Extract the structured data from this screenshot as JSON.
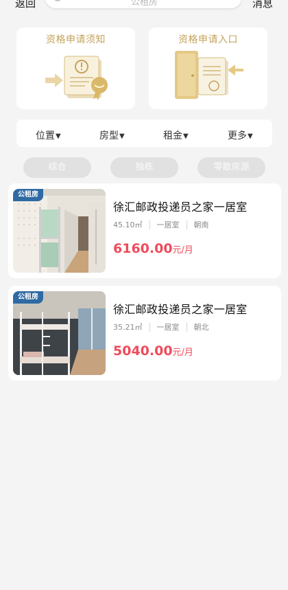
{
  "header": {
    "back_label": "返回",
    "message_label": "消息",
    "search_placeholder": "公租房"
  },
  "features": [
    {
      "title": "资格申请须知",
      "icon": "document-notice-icon"
    },
    {
      "title": "资格申请入口",
      "icon": "door-application-icon"
    }
  ],
  "filters": [
    {
      "label": "位置",
      "arrow": "▼"
    },
    {
      "label": "房型",
      "arrow": "▼"
    },
    {
      "label": "租金",
      "arrow": "▼"
    },
    {
      "label": "更多",
      "arrow": "▼"
    }
  ],
  "chips": [
    {
      "label": "综合"
    },
    {
      "label": "独栋"
    },
    {
      "label": "零散房源"
    }
  ],
  "listings": [
    {
      "tag": "公租房",
      "name": "徐汇邮政投递员之家一居室",
      "area": "45.10㎡",
      "layout": "一居室",
      "orientation": "朝南",
      "price": "6160.00",
      "unit": "元/月"
    },
    {
      "tag": "公租房",
      "name": "徐汇邮政投递员之家一居室",
      "area": "35.21㎡",
      "layout": "一居室",
      "orientation": "朝北",
      "price": "5040.00",
      "unit": "元/月"
    }
  ],
  "colors": {
    "accent_gold": "#c4a35b",
    "price_red": "#ef4b5b",
    "tag_blue": "#2f6aa3"
  }
}
